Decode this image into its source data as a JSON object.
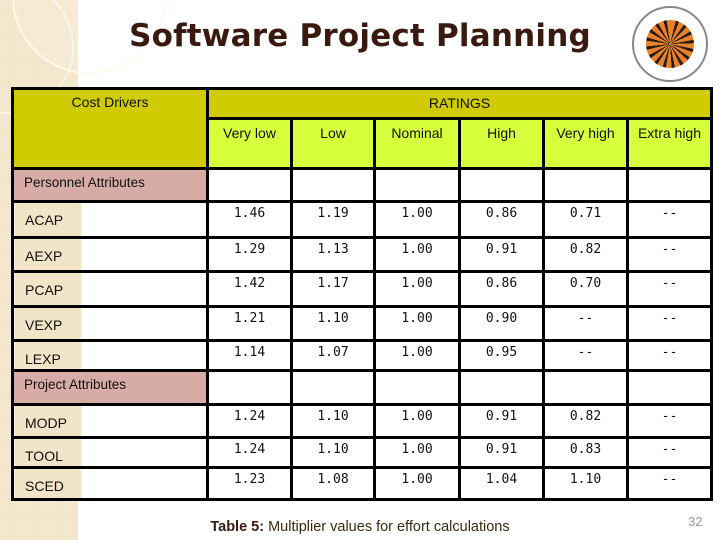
{
  "slide": {
    "title": "Software Project Planning",
    "logo": "university-seal-logo",
    "page_number": "32",
    "caption": {
      "prefix": "Table 5:",
      "text": " Multiplier values for effort calculations"
    }
  },
  "table": {
    "cost_drivers_header": "Cost Drivers",
    "ratings_header": "RATINGS",
    "columns": [
      "Very low",
      "Low",
      "Nominal",
      "High",
      "Very high",
      "Extra high"
    ],
    "colors": {
      "header_dark": "#cfcb00",
      "header_light": "#d6ff3c",
      "section": "#d8aca6"
    },
    "sections": [
      {
        "label": "Personnel Attributes",
        "rows": [
          {
            "driver": "ACAP",
            "values": [
              "1.46",
              "1.19",
              "1.00",
              "0.86",
              "0.71",
              "--"
            ]
          },
          {
            "driver": "AEXP",
            "values": [
              "1.29",
              "1.13",
              "1.00",
              "0.91",
              "0.82",
              "--"
            ]
          },
          {
            "driver": "PCAP",
            "values": [
              "1.42",
              "1.17",
              "1.00",
              "0.86",
              "0.70",
              "--"
            ]
          },
          {
            "driver": "VEXP",
            "values": [
              "1.21",
              "1.10",
              "1.00",
              "0.90",
              "--",
              "--"
            ]
          },
          {
            "driver": "LEXP",
            "values": [
              "1.14",
              "1.07",
              "1.00",
              "0.95",
              "--",
              "--"
            ]
          }
        ]
      },
      {
        "label": "Project Attributes",
        "rows": [
          {
            "driver": "MODP",
            "values": [
              "1.24",
              "1.10",
              "1.00",
              "0.91",
              "0.82",
              "--"
            ]
          },
          {
            "driver": "TOOL",
            "values": [
              "1.24",
              "1.10",
              "1.00",
              "0.91",
              "0.83",
              "--"
            ]
          },
          {
            "driver": "SCED",
            "values": [
              "1.23",
              "1.08",
              "1.00",
              "1.04",
              "1.10",
              "--"
            ]
          }
        ]
      }
    ]
  }
}
